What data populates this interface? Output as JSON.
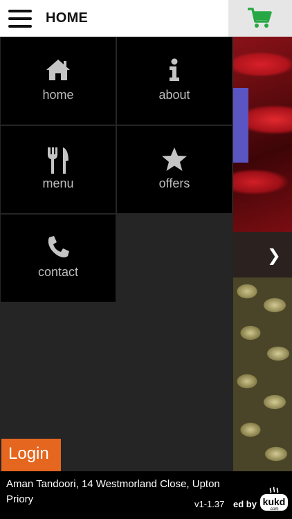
{
  "header": {
    "title": "HOME",
    "menu_icon": "hamburger-icon",
    "cart_icon": "shopping-cart-icon",
    "cart_color": "#27a844"
  },
  "menu": {
    "items": [
      {
        "label": "home",
        "icon": "house-icon"
      },
      {
        "label": "about",
        "icon": "info-icon"
      },
      {
        "label": "menu",
        "icon": "fork-knife-icon"
      },
      {
        "label": "offers",
        "icon": "star-icon"
      },
      {
        "label": "contact",
        "icon": "phone-icon"
      }
    ],
    "login_label": "Login",
    "login_color": "#e4661f"
  },
  "footer": {
    "address": "Aman Tandoori, 14 Westmorland Close, Upton Priory",
    "version": "v1-1.37",
    "powered_by": "ed by",
    "logo_text": "kukd",
    "logo_subtext": ".com"
  },
  "slider": {
    "next_icon": "chevron-right-icon"
  }
}
